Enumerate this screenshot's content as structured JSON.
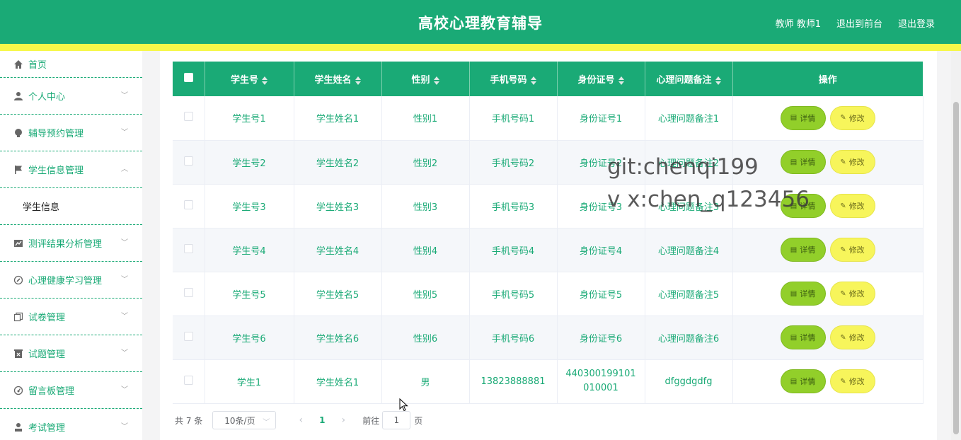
{
  "header": {
    "title": "高校心理教育辅导",
    "nav": [
      "教师 教师1",
      "退出到前台",
      "退出登录"
    ]
  },
  "sidebar": {
    "items": [
      {
        "label": "首页",
        "icon": "home-icon"
      },
      {
        "label": "个人中心",
        "icon": "user-icon"
      },
      {
        "label": "辅导预约管理",
        "icon": "bulb-icon"
      },
      {
        "label": "学生信息管理",
        "icon": "flag-icon",
        "expanded": true,
        "children": [
          "学生信息"
        ]
      },
      {
        "label": "测评结果分析管理",
        "icon": "chart-icon"
      },
      {
        "label": "心理健康学习管理",
        "icon": "compass-icon"
      },
      {
        "label": "试卷管理",
        "icon": "copy-icon"
      },
      {
        "label": "试题管理",
        "icon": "delete-box-icon"
      },
      {
        "label": "留言板管理",
        "icon": "gauge-icon"
      },
      {
        "label": "考试管理",
        "icon": "user-solid-icon"
      }
    ]
  },
  "table": {
    "columns": [
      "学生号",
      "学生姓名",
      "性别",
      "手机号码",
      "身份证号",
      "心理问题备注",
      "操作"
    ],
    "rows": [
      [
        "学生号1",
        "学生姓名1",
        "性别1",
        "手机号码1",
        "身份证号1",
        "心理问题备注1"
      ],
      [
        "学生号2",
        "学生姓名2",
        "性别2",
        "手机号码2",
        "身份证号2",
        "心理问题备注2"
      ],
      [
        "学生号3",
        "学生姓名3",
        "性别3",
        "手机号码3",
        "身份证号3",
        "心理问题备注3"
      ],
      [
        "学生号4",
        "学生姓名4",
        "性别4",
        "手机号码4",
        "身份证号4",
        "心理问题备注4"
      ],
      [
        "学生号5",
        "学生姓名5",
        "性别5",
        "手机号码5",
        "身份证号5",
        "心理问题备注5"
      ],
      [
        "学生号6",
        "学生姓名6",
        "性别6",
        "手机号码6",
        "身份证号6",
        "心理问题备注6"
      ],
      [
        "学生1",
        "学生姓名1",
        "男",
        "13823888881",
        "440300199101010001",
        "dfggdgdfg"
      ]
    ],
    "detail_label": "详情",
    "edit_label": "修改"
  },
  "pagination": {
    "total": "共 7 条",
    "page_size": "10条/页",
    "current_page": "1",
    "goto_label": "前往",
    "goto_value": "1",
    "page_suffix": "页"
  },
  "watermark": [
    "git:chenqi199",
    "v x:chen_q123456"
  ],
  "colors": {
    "primary": "#1aaa76",
    "stripe": "#f6f74a",
    "detail": "#92cf2a",
    "edit": "#f7f55b"
  }
}
